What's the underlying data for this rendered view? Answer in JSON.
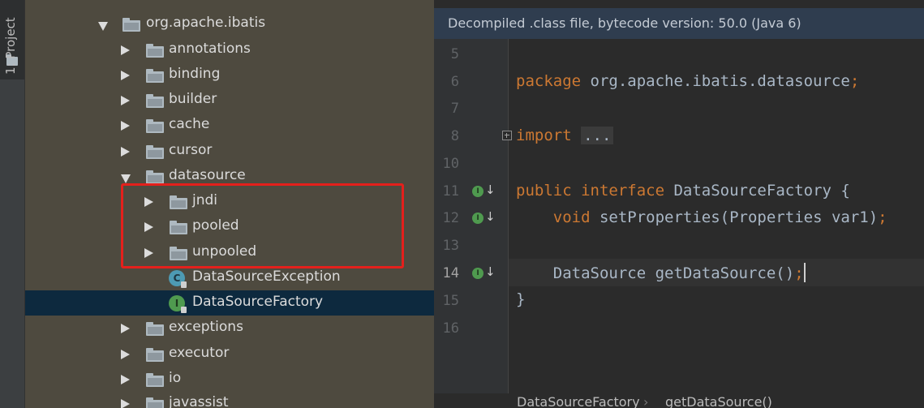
{
  "tool_window": {
    "tab_label": "1: Project",
    "tab_icon": "folder-icon"
  },
  "tree": {
    "items": [
      {
        "label": "org.apache.ibatis",
        "type": "package",
        "state": "expanded"
      },
      {
        "label": "annotations",
        "type": "package",
        "state": "collapsed"
      },
      {
        "label": "binding",
        "type": "package",
        "state": "collapsed"
      },
      {
        "label": "builder",
        "type": "package",
        "state": "collapsed"
      },
      {
        "label": "cache",
        "type": "package",
        "state": "collapsed"
      },
      {
        "label": "cursor",
        "type": "package",
        "state": "collapsed"
      },
      {
        "label": "datasource",
        "type": "package",
        "state": "expanded"
      },
      {
        "label": "jndi",
        "type": "package",
        "state": "collapsed"
      },
      {
        "label": "pooled",
        "type": "package",
        "state": "collapsed"
      },
      {
        "label": "unpooled",
        "type": "package",
        "state": "collapsed"
      },
      {
        "label": "DataSourceException",
        "type": "class",
        "icon_letter": "C"
      },
      {
        "label": "DataSourceFactory",
        "type": "interface",
        "icon_letter": "I",
        "selected": true
      },
      {
        "label": "exceptions",
        "type": "package",
        "state": "collapsed"
      },
      {
        "label": "executor",
        "type": "package",
        "state": "collapsed"
      },
      {
        "label": "io",
        "type": "package",
        "state": "collapsed"
      },
      {
        "label": "javassist",
        "type": "package",
        "state": "collapsed"
      }
    ]
  },
  "editor": {
    "banner": "Decompiled .class file, bytecode version: 50.0 (Java 6)",
    "line_numbers": [
      "5",
      "6",
      "7",
      "8",
      "10",
      "11",
      "12",
      "13",
      "14",
      "15",
      "16"
    ],
    "current_line": "14",
    "code": {
      "l6_kw": "package",
      "l6_rest": " org.apache.ibatis.datasource",
      "l6_semi": ";",
      "l8_kw": "import",
      "l8_folded": "...",
      "l11_kw1": "public",
      "l11_kw2": "interface",
      "l11_rest": " DataSourceFactory {",
      "l12_kw": "void",
      "l12_rest": " setProperties(Properties var1)",
      "l12_semi": ";",
      "l14_rest": "DataSource getDataSource()",
      "l14_semi": ";",
      "l15": "}"
    },
    "gutter_icon_letter": "I",
    "gutter_arrow": "↓"
  },
  "breadcrumb": {
    "items": [
      "DataSourceFactory",
      "getDataSource()"
    ],
    "separator": "›"
  },
  "colors": {
    "highlight_box": "#e4201c",
    "keyword": "#cc7832",
    "selection": "#0d293e"
  }
}
